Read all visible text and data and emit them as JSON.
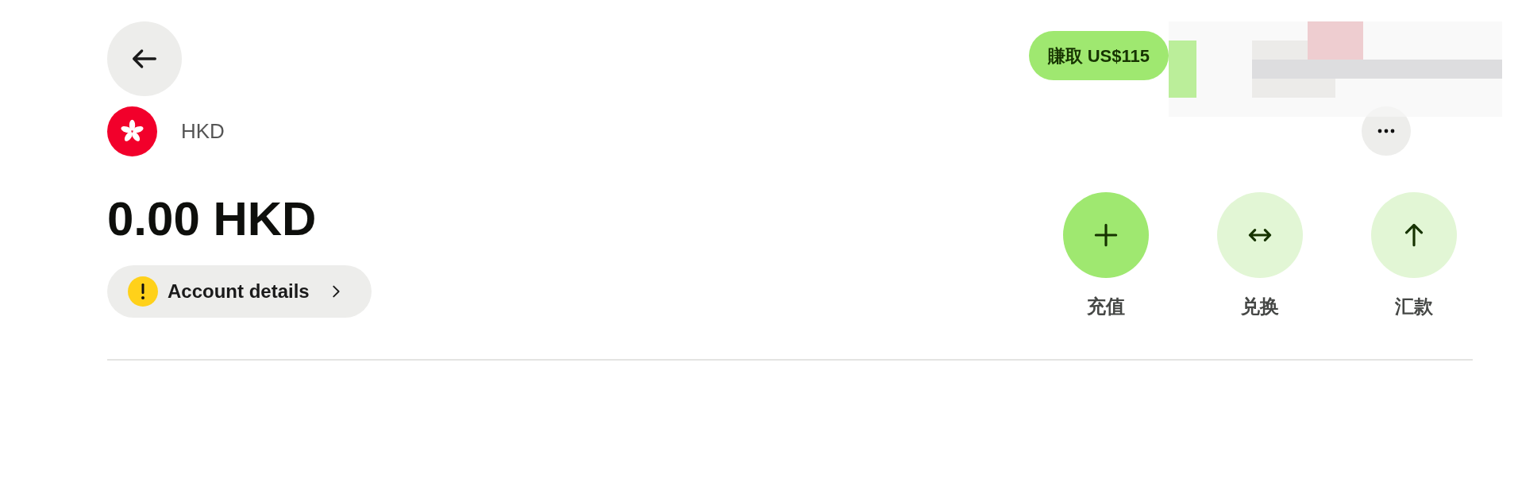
{
  "header": {
    "earn_badge": "賺取 US$115"
  },
  "account": {
    "currency": "HKD",
    "balance": "0.00 HKD",
    "details_button": {
      "label": "Account details",
      "warning": true
    }
  },
  "actions": [
    {
      "label": "充值",
      "kind": "primary"
    },
    {
      "label": "兑换",
      "kind": "secondary"
    },
    {
      "label": "汇款",
      "kind": "secondary"
    }
  ]
}
